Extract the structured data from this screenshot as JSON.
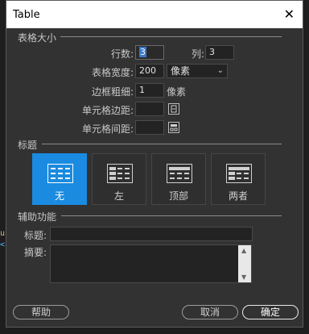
{
  "dialog": {
    "title": "Table",
    "close_glyph": "✕"
  },
  "table_section": {
    "heading": "表格大小",
    "rows_label": "行数:",
    "rows_value": "3",
    "cols_label": "列:",
    "cols_value": "3",
    "width_label": "表格宽度:",
    "width_value": "200",
    "width_unit": "像素",
    "border_label": "边框粗细:",
    "border_value": "1",
    "border_unit": "像素",
    "padding_label": "单元格边距:",
    "padding_value": "",
    "spacing_label": "单元格间距:",
    "spacing_value": ""
  },
  "header_section": {
    "heading": "标题",
    "options": [
      {
        "label": "无",
        "selected": true
      },
      {
        "label": "左",
        "selected": false
      },
      {
        "label": "顶部",
        "selected": false
      },
      {
        "label": "两者",
        "selected": false
      }
    ]
  },
  "accessibility_section": {
    "heading": "辅助功能",
    "caption_label": "标题:",
    "caption_value": "",
    "summary_label": "摘要:",
    "summary_value": ""
  },
  "buttons": {
    "help": "帮助",
    "cancel": "取消",
    "ok": "确定"
  },
  "background_code": {
    "line1": "u",
    "line2": "<"
  },
  "colors": {
    "selected_accent": "#1a8be0",
    "dialog_bg": "#323232",
    "titlebar_bg": "#ffffff"
  }
}
